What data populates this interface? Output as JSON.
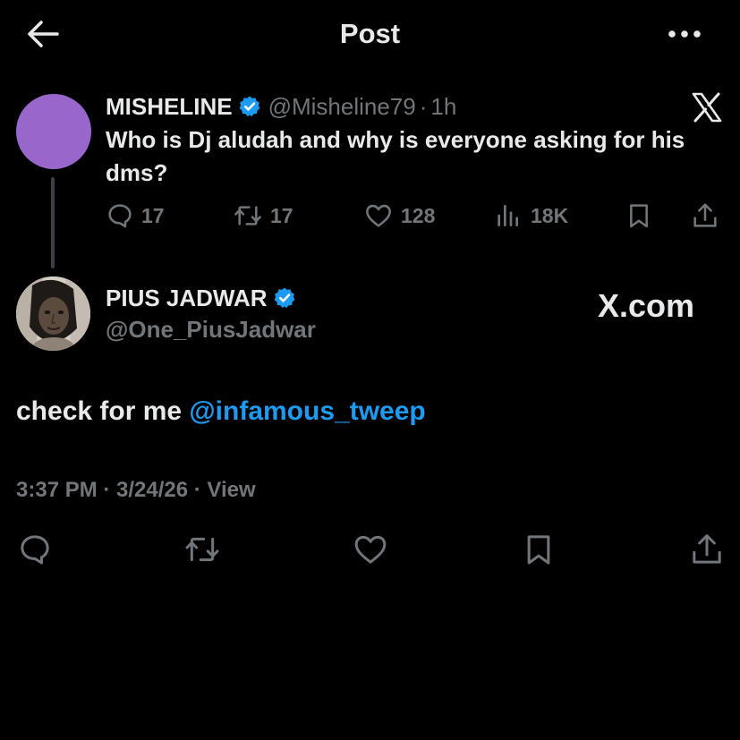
{
  "header": {
    "title": "Post",
    "back_icon": "arrow-left-icon",
    "more_icon": "more-horizontal-icon"
  },
  "parent_post": {
    "display_name": "MISHELINE",
    "handle": "@Misheline79",
    "separator": "·",
    "time_ago": "1h",
    "text": "Who is Dj aludah and why is everyone asking for his dms?",
    "avatar_color": "#9966cc",
    "metrics": {
      "replies": "17",
      "reposts": "17",
      "likes": "128",
      "views": "18K"
    }
  },
  "reply_post": {
    "display_name": "PIUS JADWAR",
    "handle": "@One_PiusJadwar",
    "watermark": "X.com",
    "text_prefix": "check for me ",
    "mention": "@infamous_tweep",
    "timestamp": "3:37 PM · 3/24/26 · View"
  },
  "colors": {
    "background": "#000000",
    "text": "#e7e9ea",
    "muted": "#71767b",
    "accent": "#1d9bf0",
    "verified": "#1d9bf0"
  }
}
